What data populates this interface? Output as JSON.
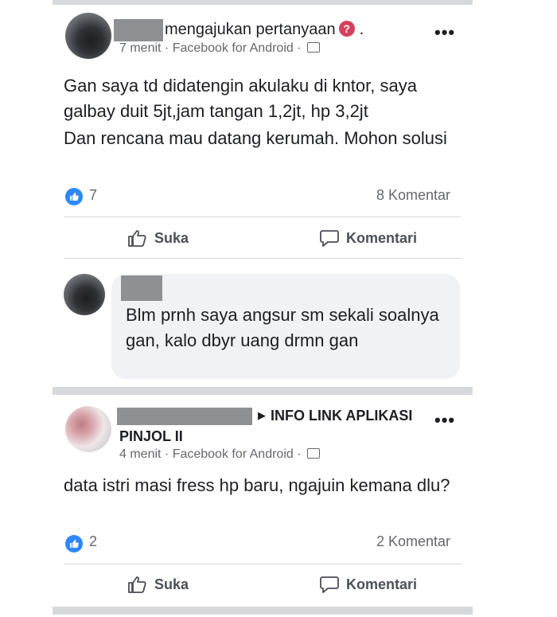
{
  "post1": {
    "header_text": "mengajukan pertanyaan",
    "header_suffix": ".",
    "question_icon_glyph": "?",
    "meta": "7 menit · Facebook for Android ·",
    "more_label": "•••",
    "body_line1": "Gan saya td didatengin akulaku di kntor, saya galbay duit 5jt,jam tangan 1,2jt, hp 3,2jt",
    "body_line2": "Dan rencana mau datang kerumah. Mohon solusi",
    "like_count": "7",
    "comment_count": "8 Komentar",
    "like_label": "Suka",
    "comment_label": "Komentari"
  },
  "comment1": {
    "text": "Blm prnh saya angsur sm sekali soalnya gan, kalo dbyr uang drmn gan"
  },
  "post2": {
    "group_arrow": "▶",
    "group_name_line1": "INFO LINK APLIKASI",
    "group_name_line2": "PINJOL II",
    "meta": "4 menit · Facebook for Android ·",
    "more_label": "•••",
    "body": "data istri masi fress hp baru, ngajuin kemana dlu?",
    "like_count": "2",
    "comment_count": "2 Komentar",
    "like_label": "Suka",
    "comment_label": "Komentari"
  },
  "colors": {
    "like_blue": "#2d88ff",
    "question_red": "#d6405a",
    "separator": "#d6d8dc",
    "bubble_bg": "#f0f2f5"
  }
}
